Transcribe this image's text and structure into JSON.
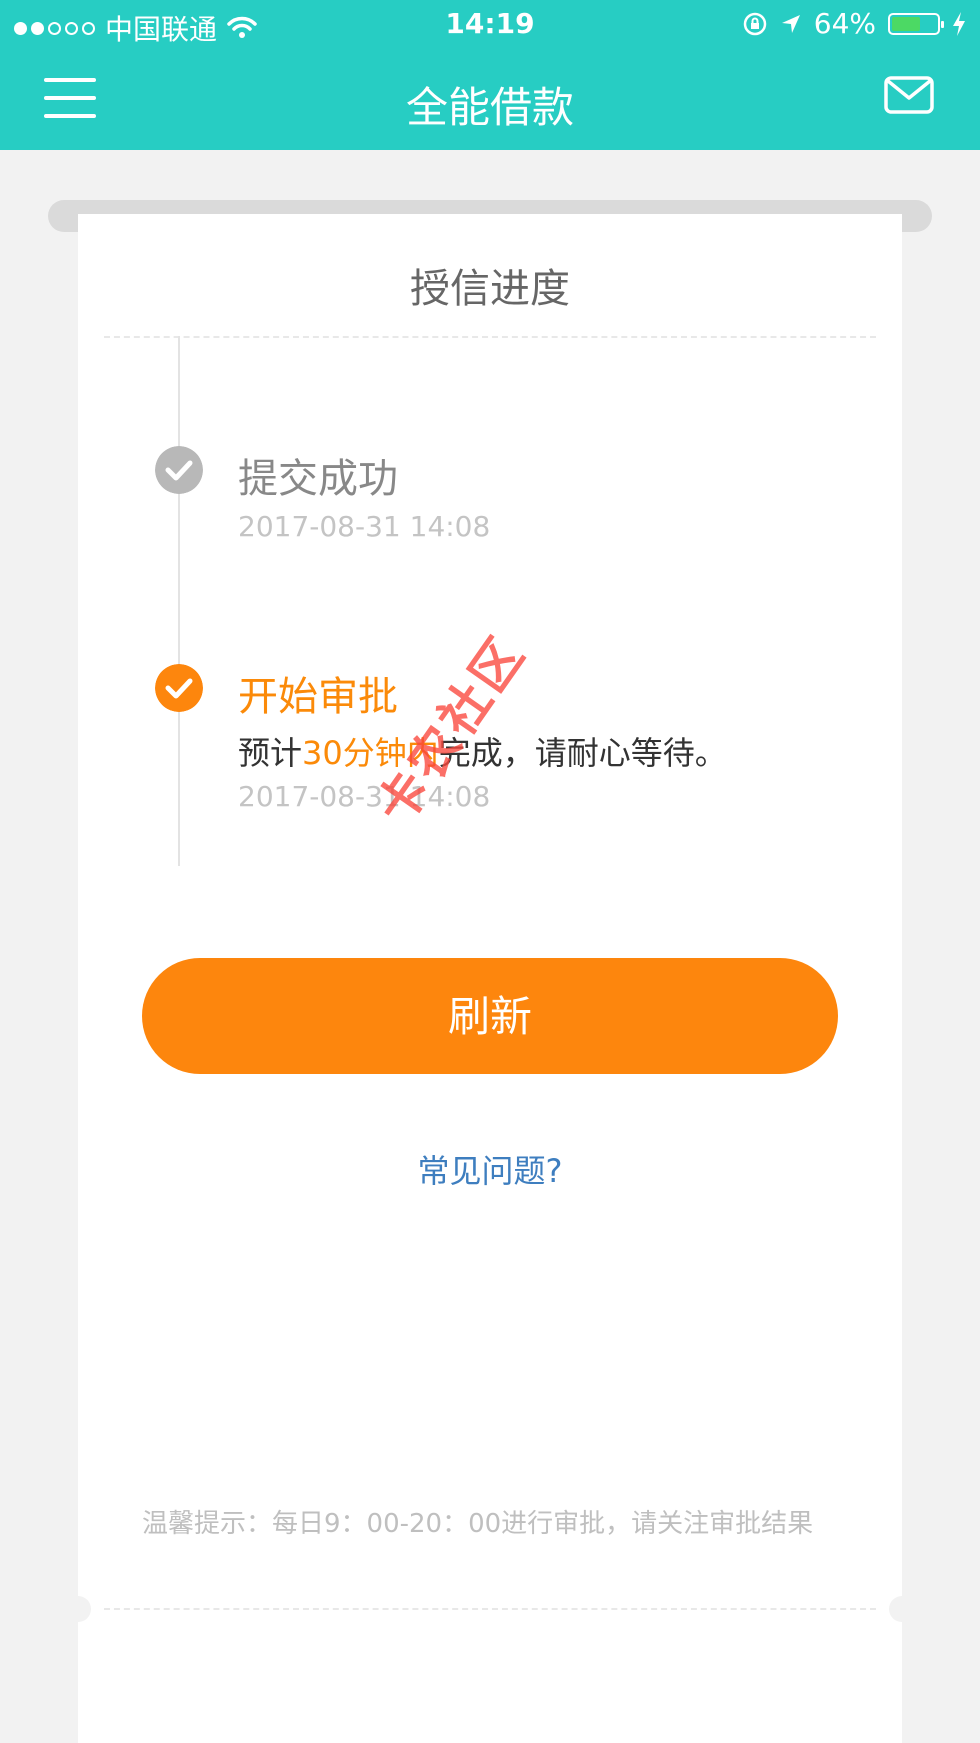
{
  "status_bar": {
    "carrier": "中国联通",
    "time": "14:19",
    "battery_percent": "64%",
    "battery_level": 0.64,
    "signal_dots_filled": 2,
    "signal_dots_total": 5
  },
  "nav": {
    "title": "全能借款",
    "menu_icon": "hamburger-menu-icon",
    "mail_icon": "mail-icon"
  },
  "card": {
    "title": "授信进度",
    "steps": [
      {
        "title": "提交成功",
        "time": "2017-08-31 14:08",
        "state": "done"
      },
      {
        "title": "开始审批",
        "desc_prefix": "预计",
        "desc_highlight": "30分钟内",
        "desc_suffix": "完成，请耐心等待。",
        "time": "2017-08-31 14:08",
        "state": "active"
      }
    ],
    "refresh_label": "刷新",
    "faq_link": "常见问题?",
    "tip": "温馨提示：每日9：00-20：00进行审批，请关注审批结果"
  },
  "watermark": "卡农社区",
  "colors": {
    "brand_teal": "#27cdc3",
    "accent_orange": "#fd860d",
    "link_blue": "#3e7ebf",
    "done_gray": "#b8b8b8"
  }
}
